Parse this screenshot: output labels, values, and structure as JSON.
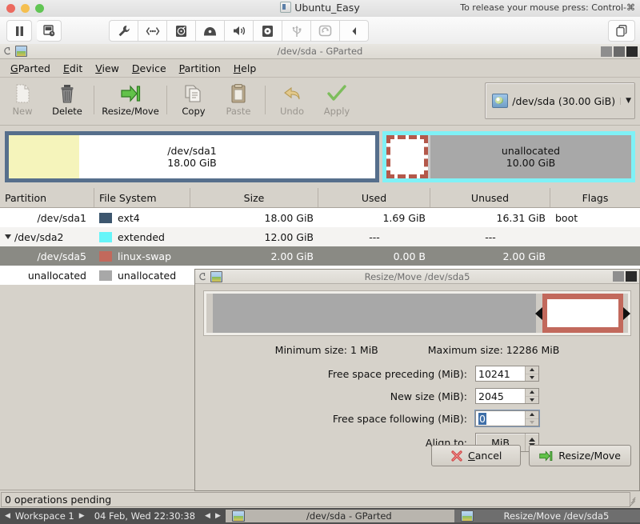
{
  "vm": {
    "title": "Ubuntu_Easy",
    "release_hint": "To release your mouse press: Control-⌘",
    "toolbar_left": [
      {
        "name": "pause-button",
        "icon": "pause-icon"
      },
      {
        "name": "snapshot-button",
        "icon": "snapshot-icon"
      }
    ],
    "toolbar_mid": [
      {
        "name": "settings-button",
        "icon": "wrench-icon"
      },
      {
        "name": "network-button",
        "icon": "network-icon"
      },
      {
        "name": "harddisk-button",
        "icon": "hard-disk-icon"
      },
      {
        "name": "floppy-button",
        "icon": "floppy-icon"
      },
      {
        "name": "audio-button",
        "icon": "speaker-icon"
      },
      {
        "name": "optical-button",
        "icon": "optical-disc-icon"
      },
      {
        "name": "usb-button",
        "icon": "usb-icon"
      },
      {
        "name": "shared-folders-button",
        "icon": "shared-folders-icon"
      },
      {
        "name": "collapse-button",
        "icon": "chevron-left-icon"
      }
    ],
    "toolbar_right": [
      {
        "name": "fullscreen-button",
        "icon": "copy-window-icon"
      }
    ]
  },
  "gparted": {
    "window_title": "/dev/sda - GParted",
    "menu": [
      "GParted",
      "Edit",
      "View",
      "Device",
      "Partition",
      "Help"
    ],
    "toolbar": [
      {
        "label": "New",
        "disabled": true
      },
      {
        "label": "Delete",
        "disabled": false
      },
      {
        "label": "Resize/Move",
        "disabled": false
      },
      {
        "label": "Copy",
        "disabled": false
      },
      {
        "label": "Paste",
        "disabled": true
      },
      {
        "label": "Undo",
        "disabled": true
      },
      {
        "label": "Apply",
        "disabled": true
      }
    ],
    "device_selector": {
      "label": "/dev/sda  (30.00 GiB)",
      "arrow": "▼"
    },
    "graphic": [
      {
        "name": "/dev/sda1",
        "size": "18.00 GiB"
      },
      {
        "name": "unallocated",
        "size": "10.00 GiB"
      }
    ],
    "table": {
      "headers": [
        "Partition",
        "File System",
        "Size",
        "Used",
        "Unused",
        "Flags"
      ],
      "rows": [
        {
          "partition": "/dev/sda1",
          "fs": "ext4",
          "fs_color": "#3d566e",
          "size": "18.00 GiB",
          "used": "1.69 GiB",
          "unused": "16.31 GiB",
          "flags": "boot",
          "indent": 0,
          "expander": false,
          "selected": false
        },
        {
          "partition": "/dev/sda2",
          "fs": "extended",
          "fs_color": "#66f5f9",
          "size": "12.00 GiB",
          "used": "---",
          "unused": "---",
          "flags": "",
          "indent": 0,
          "expander": true,
          "selected": false
        },
        {
          "partition": "/dev/sda5",
          "fs": "linux-swap",
          "fs_color": "#c2695c",
          "size": "2.00 GiB",
          "used": "0.00 B",
          "unused": "2.00 GiB",
          "flags": "",
          "indent": 1,
          "expander": false,
          "selected": true
        },
        {
          "partition": "unallocated",
          "fs": "unallocated",
          "fs_color": "#a8a8a8",
          "size": "",
          "used": "",
          "unused": "",
          "flags": "",
          "indent": 0,
          "expander": false,
          "selected": false
        }
      ]
    },
    "status": "0 operations pending"
  },
  "dialog": {
    "title": "Resize/Move /dev/sda5",
    "minimum_size": "Minimum size: 1 MiB",
    "maximum_size": "Maximum size: 12286 MiB",
    "fields": [
      {
        "label": "Free space preceding (MiB):",
        "value": "10241",
        "type": "spin",
        "selected": false
      },
      {
        "label": "New size (MiB):",
        "value": "2045",
        "type": "spin",
        "selected": false
      },
      {
        "label": "Free space following (MiB):",
        "value": "0",
        "type": "spin",
        "selected": true
      },
      {
        "label": "Align to:",
        "value": "MiB",
        "type": "combo",
        "selected": false
      }
    ],
    "cancel_label": "Cancel",
    "confirm_label": "Resize/Move"
  },
  "taskbar": {
    "workspace": "Workspace 1",
    "clock": "04 Feb, Wed 22:30:38",
    "windows": [
      {
        "title": "/dev/sda - GParted",
        "active": false
      },
      {
        "title": "Resize/Move /dev/sda5",
        "active": true
      }
    ]
  }
}
